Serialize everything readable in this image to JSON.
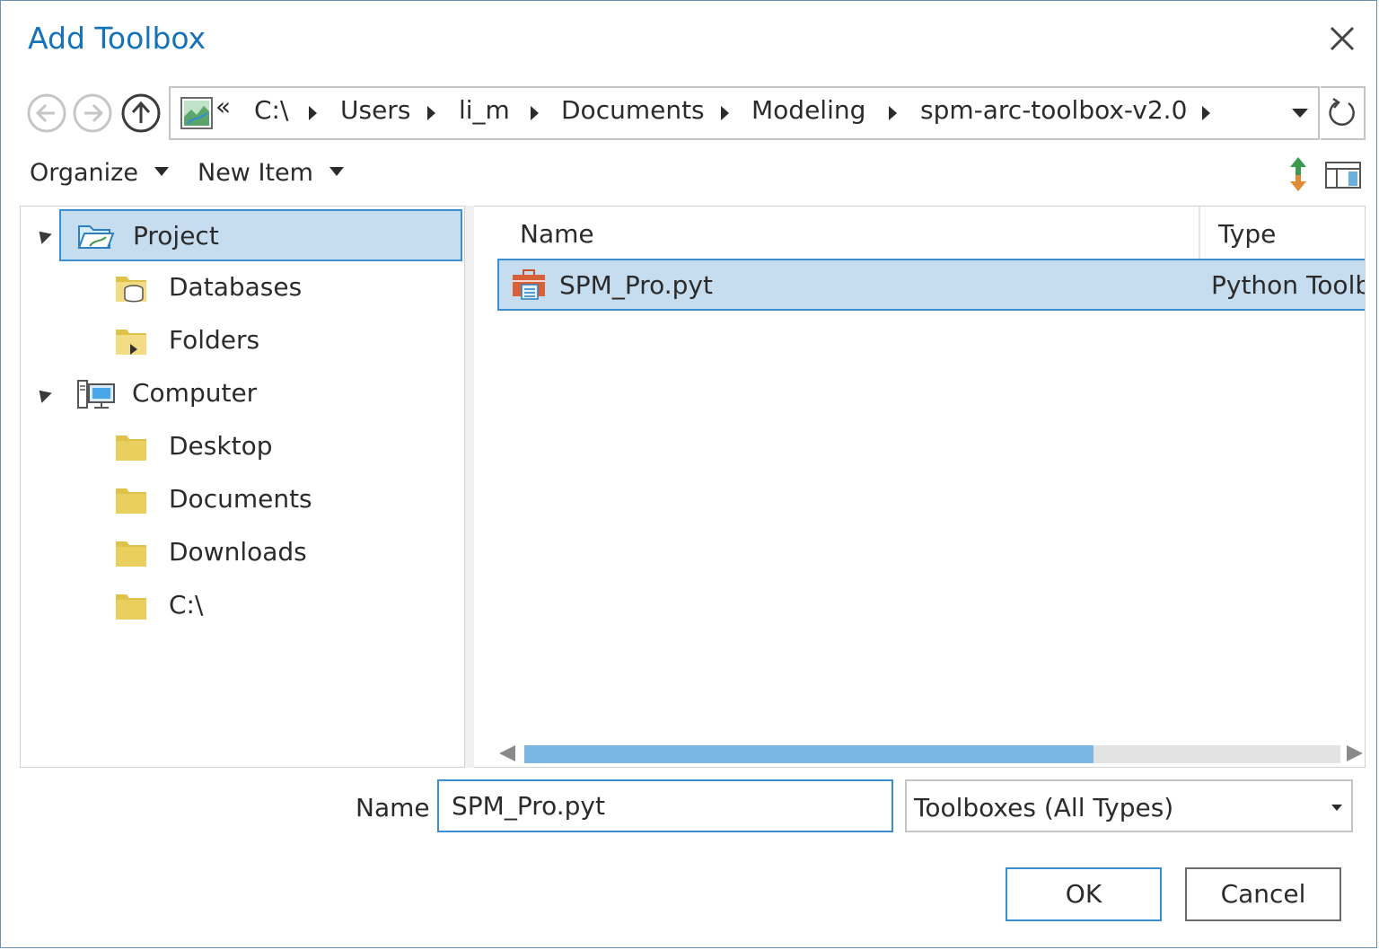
{
  "dialog": {
    "title": "Add Toolbox"
  },
  "breadcrumb": {
    "overflow": "«",
    "items": [
      "C:\\",
      "Users",
      "li_m",
      "Documents",
      "Modeling",
      "spm-arc-toolbox-v2.0"
    ]
  },
  "toolbar": {
    "organize": "Organize",
    "new_item": "New Item"
  },
  "tree": {
    "project": "Project",
    "databases": "Databases",
    "folders": "Folders",
    "computer": "Computer",
    "desktop": "Desktop",
    "documents": "Documents",
    "downloads": "Downloads",
    "c_drive": "C:\\"
  },
  "list": {
    "columns": {
      "name": "Name",
      "type": "Type"
    },
    "rows": [
      {
        "name": "SPM_Pro.pyt",
        "type": "Python Toolb"
      }
    ]
  },
  "footer": {
    "name_label": "Name",
    "name_value": "SPM_Pro.pyt",
    "filter_value": "Toolboxes (All Types)",
    "ok": "OK",
    "cancel": "Cancel"
  },
  "colors": {
    "accent": "#1773b8",
    "selection": "#c6dcef",
    "selection_border": "#3b8fd0",
    "folder": "#e0c24a"
  }
}
